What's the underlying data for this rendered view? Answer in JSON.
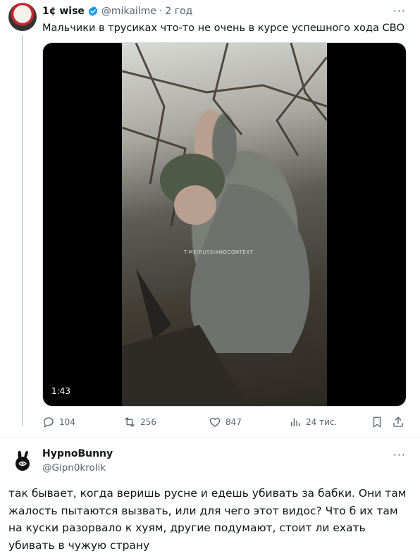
{
  "tweet": {
    "author_name": "1¢ wise",
    "handle": "@mikailme",
    "separator": "·",
    "time": "2 год",
    "more": "···",
    "text": "Мальчики в трусиках что-то не очень в курсе успешного хода СВО",
    "media": {
      "watermark": "T.ME/RUSSIANOCONTEXT",
      "duration": "1:43"
    },
    "actions": {
      "replies": "104",
      "retweets": "256",
      "likes": "847",
      "views": "24 тис."
    },
    "colors": {
      "verified": "#1d9bf0",
      "secondary_text": "#536471"
    }
  },
  "reply": {
    "author_name": "HypnoBunny",
    "handle": "@Gipn0krolik",
    "more": "···",
    "text": "так бывает, когда веришь русне и едешь убивать за бабки. Они там жалость пытаются вызвать, или для чего этот видос? Что б их там на куски разорвало к хуям, другие подумают, стоит ли ехать убивать в чужую страну"
  },
  "icons": [
    "verified-icon",
    "reply-icon",
    "retweet-icon",
    "like-icon",
    "views-icon",
    "bookmark-icon",
    "share-icon",
    "more-icon"
  ]
}
